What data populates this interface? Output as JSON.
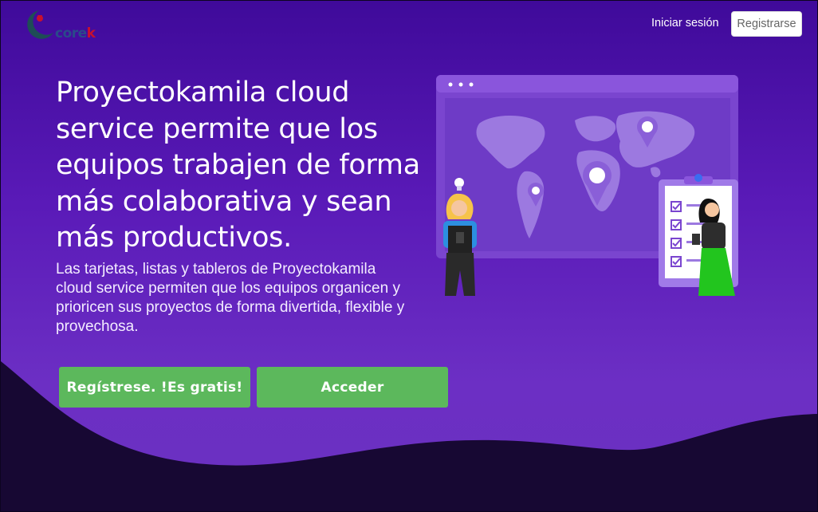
{
  "brand": {
    "name_prefix": "core",
    "name_suffix": "k",
    "colors": {
      "blue": "#2a4a8a",
      "red": "#c8102e"
    }
  },
  "nav": {
    "login_label": "Iniciar sesión",
    "register_label": "Registrarse"
  },
  "hero": {
    "headline": "Proyectokamila cloud service permite que los equipos trabajen de forma más colaborativa y sean más productivos.",
    "subtext": "Las tarjetas, listas y tableros de Proyectokamila cloud service permiten que los equipos organicen y prioricen sus proyectos de forma divertida, flexible y provechosa.",
    "signup_label": "Regístrese. !Es gratis!",
    "access_label": "Acceder"
  },
  "colors": {
    "accent_green": "#5cb85c",
    "background_top": "#3f0a9a",
    "background_bottom": "#6c2fc4",
    "wave": "#170833"
  },
  "icons": [
    "world-map-illustration",
    "checklist-icon",
    "location-pin-icon"
  ]
}
